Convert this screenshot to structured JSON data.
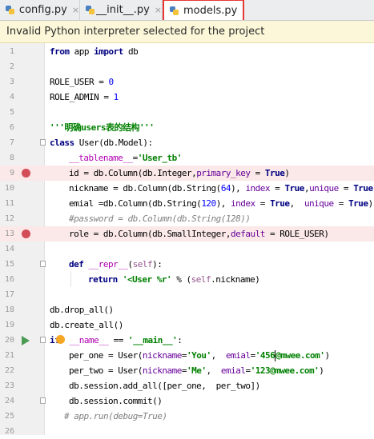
{
  "tabs": [
    {
      "label": "config.py",
      "close": "×",
      "active": false
    },
    {
      "label": "__init__.py",
      "close": "×",
      "active": false
    },
    {
      "label": "models.py",
      "close": "",
      "active": true
    }
  ],
  "banner": {
    "text": "Invalid Python interpreter selected for the project"
  },
  "line_numbers": [
    "1",
    "2",
    "3",
    "4",
    "5",
    "6",
    "7",
    "8",
    "9",
    "10",
    "11",
    "12",
    "13",
    "14",
    "15",
    "16",
    "17",
    "18",
    "19",
    "20",
    "21",
    "22",
    "23",
    "24",
    "25",
    "26"
  ],
  "code": {
    "l1": {
      "from": "from",
      "mod": " app ",
      "import": "import",
      "name": " db"
    },
    "l3": "ROLE_USER = ",
    "l3num": "0",
    "l4": "ROLE_ADMIN = ",
    "l4num": "1",
    "l6": "'''明确users表的结构'''",
    "l7kw": "class",
    "l7rest": " User(db.Model):",
    "l8a": "__tablename__",
    "l8b": "=",
    "l8str": "'User_tb'",
    "l9a": "id = db.Column(db.Integer,",
    "l9p": "primary_key",
    "l9b": " = ",
    "l9kw": "True",
    "l9c": ")",
    "l10a": "nickname = db.Column(db.String(",
    "l10n": "64",
    "l10b": "), ",
    "l10p": "index",
    "l10c": " = ",
    "l10kw": "True",
    "l10d": ",",
    "l10p2": "unique",
    "l10e": " = ",
    "l10kw2": "True",
    "l10f": ")",
    "l11a": "emial =db.Column(db.String(",
    "l11n": "120",
    "l11b": "), ",
    "l11p": "index",
    "l11c": " = ",
    "l11kw": "True",
    "l11d": ",  ",
    "l11p2": "unique",
    "l11e": " = ",
    "l11kw2": "True",
    "l11f": ")",
    "l12": "#password = db.Column(db.String(128))",
    "l13a": "role = db.Column(db.SmallInteger,",
    "l13p": "default",
    "l13b": " = ROLE_USER)",
    "l15kw": "def",
    "l15name": " __repr__",
    "l15a": "(",
    "l15self": "self",
    "l15b": "):",
    "l16kw": "return",
    "l16str": " '<User %r' ",
    "l16a": "% (",
    "l16self": "self",
    "l16b": ".nickname)",
    "l18": "db.drop_all()",
    "l19": "db.create_all()",
    "l20kw": "if",
    "l20a": "__name__",
    "l20b": " == ",
    "l20str": "'__main__'",
    "l20c": ":",
    "l21a": "per_one = User(",
    "l21p": "nickname",
    "l21b": "=",
    "l21s": "'You'",
    "l21c": ",  ",
    "l21p2": "emial",
    "l21d": "=",
    "l21s2": "'456",
    "l21s3": "@mwee.com'",
    "l21e": ")",
    "l22a": "per_two = User(",
    "l22p": "nickname",
    "l22b": "=",
    "l22s": "'Me'",
    "l22c": ",  ",
    "l22p2": "emial",
    "l22d": "=",
    "l22s2": "'123@mwee.com'",
    "l22e": ")",
    "l23": "db.session.add_all([per_one,  per_two])",
    "l24": "db.session.commit()",
    "l25": "# app.run(debug=True)"
  },
  "colors": {
    "breakpoint": "#d24d57",
    "highlight_line": "#fbe8e8",
    "tab_highlight": "#e53935"
  }
}
